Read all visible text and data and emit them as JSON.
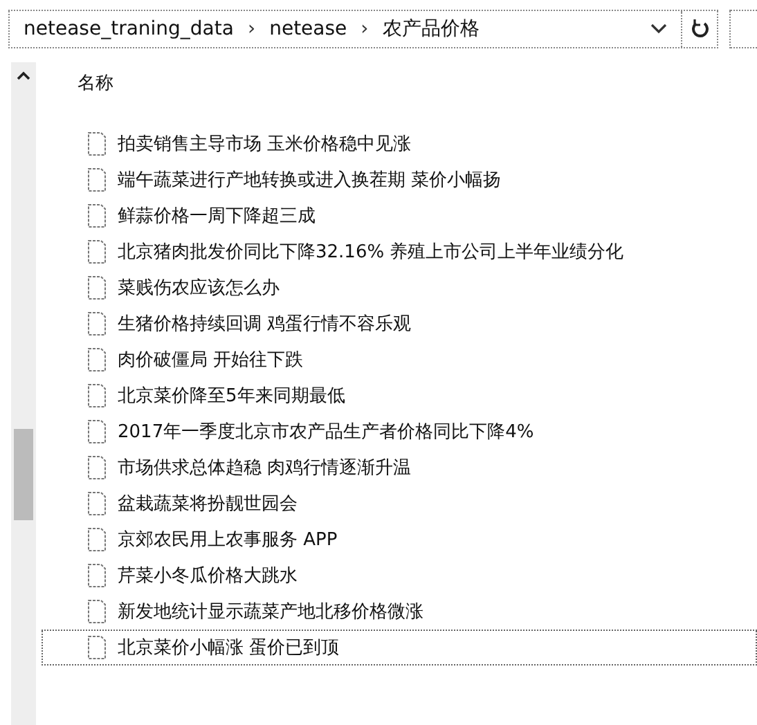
{
  "address_bar": {
    "crumbs": [
      "netease_traning_data",
      "netease",
      "农产品价格"
    ],
    "separator": "›"
  },
  "header": {
    "name_column": "名称"
  },
  "files": [
    {
      "name": "拍卖销售主导市场 玉米价格稳中见涨",
      "selected": false
    },
    {
      "name": "端午蔬菜进行产地转换或进入换茬期 菜价小幅扬",
      "selected": false
    },
    {
      "name": "鲜蒜价格一周下降超三成",
      "selected": false
    },
    {
      "name": "北京猪肉批发价同比下降32.16% 养殖上市公司上半年业绩分化",
      "selected": false
    },
    {
      "name": "菜贱伤农应该怎么办",
      "selected": false
    },
    {
      "name": "生猪价格持续回调 鸡蛋行情不容乐观",
      "selected": false
    },
    {
      "name": "肉价破僵局 开始往下跌",
      "selected": false
    },
    {
      "name": "北京菜价降至5年来同期最低",
      "selected": false
    },
    {
      "name": "2017年一季度北京市农产品生产者价格同比下降4%",
      "selected": false
    },
    {
      "name": "市场供求总体趋稳 肉鸡行情逐渐升温",
      "selected": false
    },
    {
      "name": "盆栽蔬菜将扮靓世园会",
      "selected": false
    },
    {
      "name": "京郊农民用上农事服务 APP",
      "selected": false
    },
    {
      "name": "芹菜小冬瓜价格大跳水",
      "selected": false
    },
    {
      "name": "新发地统计显示蔬菜产地北移价格微涨",
      "selected": false
    },
    {
      "name": "北京菜价小幅涨 蛋价已到顶",
      "selected": true
    }
  ]
}
